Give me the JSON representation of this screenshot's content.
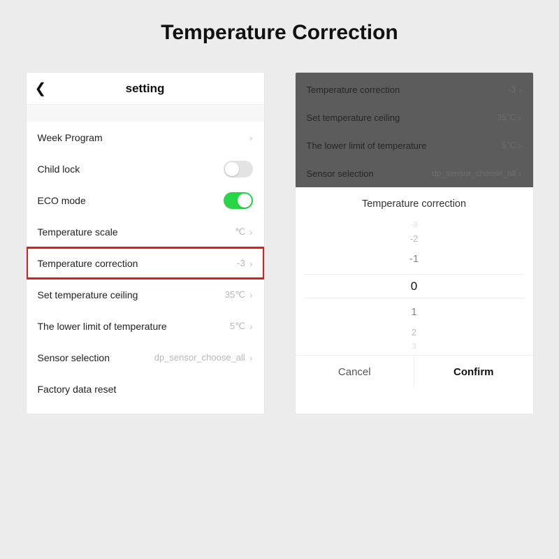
{
  "page": {
    "title": "Temperature Correction"
  },
  "left": {
    "header": "setting",
    "items": {
      "week": {
        "label": "Week Program"
      },
      "child": {
        "label": "Child lock"
      },
      "eco": {
        "label": "ECO mode"
      },
      "scale": {
        "label": "Temperature scale",
        "value": "℃"
      },
      "corr": {
        "label": "Temperature correction",
        "value": "-3"
      },
      "ceil": {
        "label": "Set temperature ceiling",
        "value": "35℃"
      },
      "lower": {
        "label": "The lower limit of temperature",
        "value": "5℃"
      },
      "sensor": {
        "label": "Sensor selection",
        "value": "dp_sensor_choose_all"
      },
      "reset": {
        "label": "Factory data reset"
      }
    }
  },
  "right": {
    "dimmed": {
      "corr": {
        "label": "Temperature correction",
        "value": "-3"
      },
      "ceil": {
        "label": "Set temperature ceiling",
        "value": "35℃"
      },
      "lower": {
        "label": "The lower limit of temperature",
        "value": "5℃"
      },
      "sensor": {
        "label": "Sensor selection",
        "value": "dp_sensor_choose_all"
      }
    },
    "sheet": {
      "title": "Temperature correction",
      "values": {
        "n3": "-3",
        "n2": "-2",
        "n1": "-1",
        "z": "0",
        "p1": "1",
        "p2": "2",
        "p3": "3"
      },
      "cancel": "Cancel",
      "confirm": "Confirm"
    }
  }
}
